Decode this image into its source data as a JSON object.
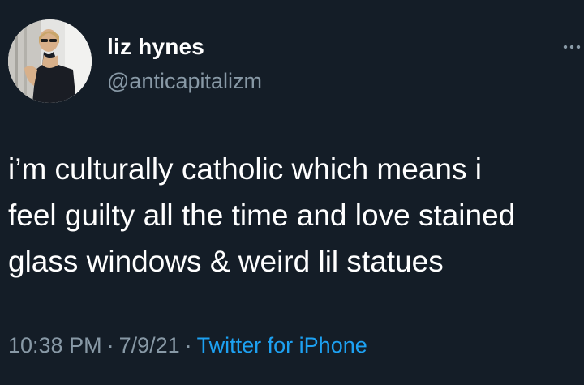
{
  "tweet": {
    "author": {
      "display_name": "liz hynes",
      "handle": "@anticapitalizm",
      "avatar_icon": "profile-photo"
    },
    "more_icon": "more-horizontal-icon",
    "text": "i’m culturally catholic which means i\nfeel guilty all the time and love stained\nglass windows & weird lil statues",
    "time": "10:38 PM",
    "separator_1": "·",
    "date": "7/9/21",
    "separator_2": "·",
    "source": "Twitter for iPhone"
  },
  "colors": {
    "background": "#141d27",
    "primary_text": "#ffffff",
    "secondary_text": "#8899a6",
    "accent": "#1da1f2"
  }
}
